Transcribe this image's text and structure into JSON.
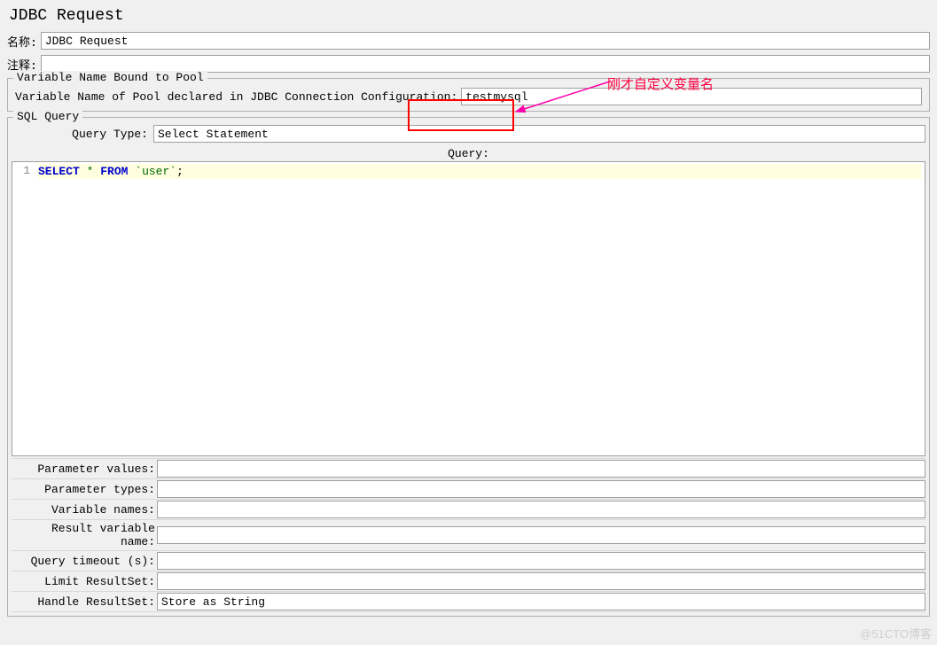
{
  "title": "JDBC Request",
  "labels": {
    "name": "名称:",
    "comment": "注释:"
  },
  "values": {
    "name": "JDBC Request",
    "comment": ""
  },
  "pool": {
    "legend": "Variable Name Bound to Pool",
    "label": "Variable Name of Pool declared in JDBC Connection Configuration:",
    "value": "testmysql"
  },
  "sql": {
    "legend": "SQL Query",
    "query_type_label": "Query Type:",
    "query_type_value": "Select Statement",
    "query_label": "Query:",
    "line_number": "1",
    "tokens": {
      "select": "SELECT",
      "star": "*",
      "from": "FROM",
      "ident": "`user`",
      "semi": ";"
    }
  },
  "params": {
    "parameter_values": {
      "label": "Parameter values:",
      "value": ""
    },
    "parameter_types": {
      "label": "Parameter types:",
      "value": ""
    },
    "variable_names": {
      "label": "Variable names:",
      "value": ""
    },
    "result_variable": {
      "label": "Result variable name:",
      "value": ""
    },
    "query_timeout": {
      "label": "Query timeout (s):",
      "value": ""
    },
    "limit_resultset": {
      "label": "Limit ResultSet:",
      "value": ""
    },
    "handle_resultset": {
      "label": "Handle ResultSet:",
      "value": "Store as String"
    }
  },
  "annotation": {
    "text": "刚才自定义变量名"
  },
  "watermark": "@51CTO博客"
}
